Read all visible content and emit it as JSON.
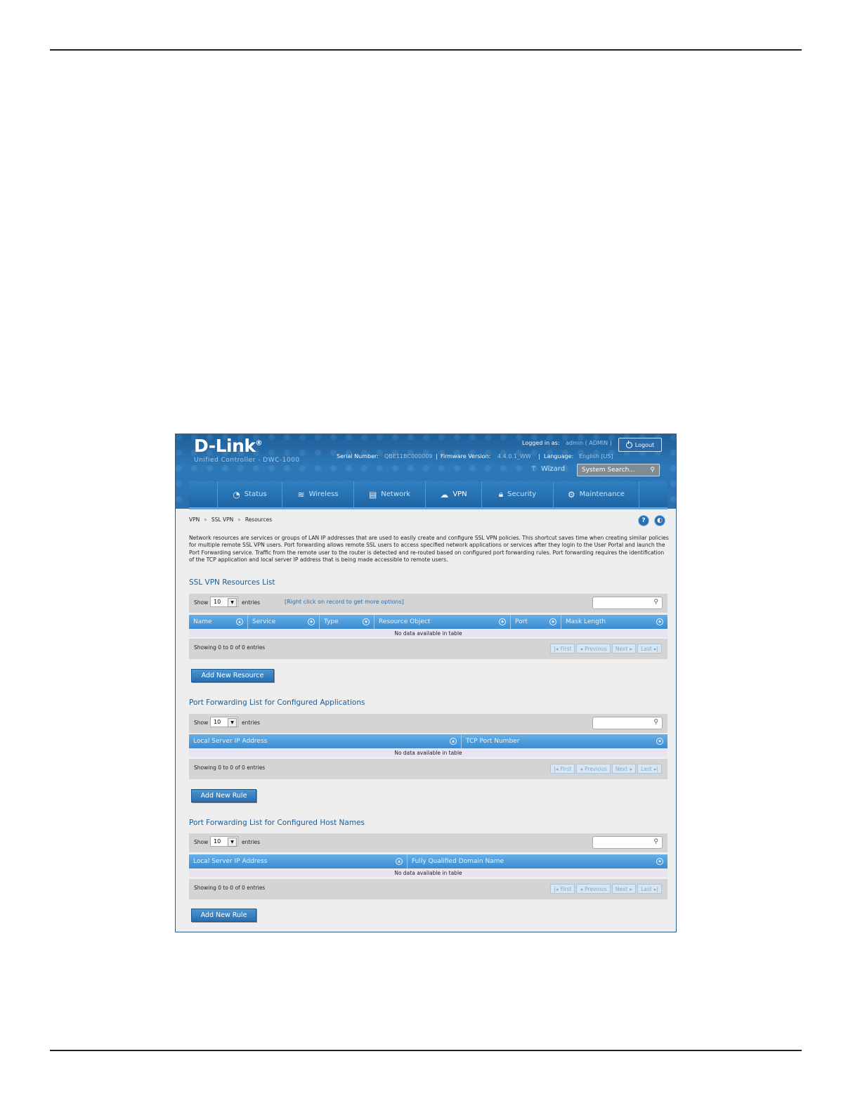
{
  "header": {
    "brand": "D-Link",
    "brand_mark": "®",
    "subtitle": "Unified Controller - DWC-1000",
    "logged_in_label": "Logged in as:",
    "logged_in_user": "admin ( ADMIN )",
    "logout_label": "Logout",
    "serial_label": "Serial Number:",
    "serial_value": "QBE11BC000009",
    "firmware_label": "Firmware Version:",
    "firmware_value": "4.4.0.1_WW",
    "language_label": "Language:",
    "language_value": "English [US]",
    "wizard_label": "Wizard",
    "system_search_placeholder": "System Search..."
  },
  "nav": {
    "items": [
      {
        "label": "Status",
        "icon": "gauge-icon"
      },
      {
        "label": "Wireless",
        "icon": "wifi-icon"
      },
      {
        "label": "Network",
        "icon": "server-icon"
      },
      {
        "label": "VPN",
        "icon": "cloud-lock-icon",
        "active": true
      },
      {
        "label": "Security",
        "icon": "lock-icon"
      },
      {
        "label": "Maintenance",
        "icon": "gears-icon"
      }
    ]
  },
  "breadcrumb": [
    "VPN",
    "SSL VPN",
    "Resources"
  ],
  "breadcrumb_sep": "»",
  "intro": "Network resources are services or groups of LAN IP addresses that are used to easily create and configure SSL VPN policies. This shortcut saves time when creating similar policies for multiple remote SSL VPN users. Port forwarding allows remote SSL users to access specified network applications or services after they login to the User Portal and launch the Port Forwarding service. Traffic from the remote user to the router is detected and re-routed based on configured port forwarding rules. Port forwarding requires the identification of the TCP application and local server IP address that is being made accessible to remote users.",
  "common": {
    "show_label": "Show",
    "show_value": "10",
    "entries_label": "entries",
    "no_data": "No data available in table",
    "showing": "Showing 0 to 0 of 0 entries",
    "pager": [
      "First",
      "Previous",
      "Next",
      "Last"
    ]
  },
  "resources": {
    "title": "SSL VPN Resources List",
    "hint": "[Right click on record to get more options]",
    "columns": [
      "Name",
      "Service",
      "Type",
      "Resource Object",
      "Port",
      "Mask Length"
    ],
    "button": "Add New Resource"
  },
  "apps": {
    "title": "Port Forwarding List for Configured Applications",
    "columns": [
      "Local Server IP Address",
      "TCP Port Number"
    ],
    "button": "Add New Rule"
  },
  "hosts": {
    "title": "Port Forwarding List for Configured Host Names",
    "columns": [
      "Local Server IP Address",
      "Fully Qualified Domain Name"
    ],
    "button": "Add New Rule"
  }
}
